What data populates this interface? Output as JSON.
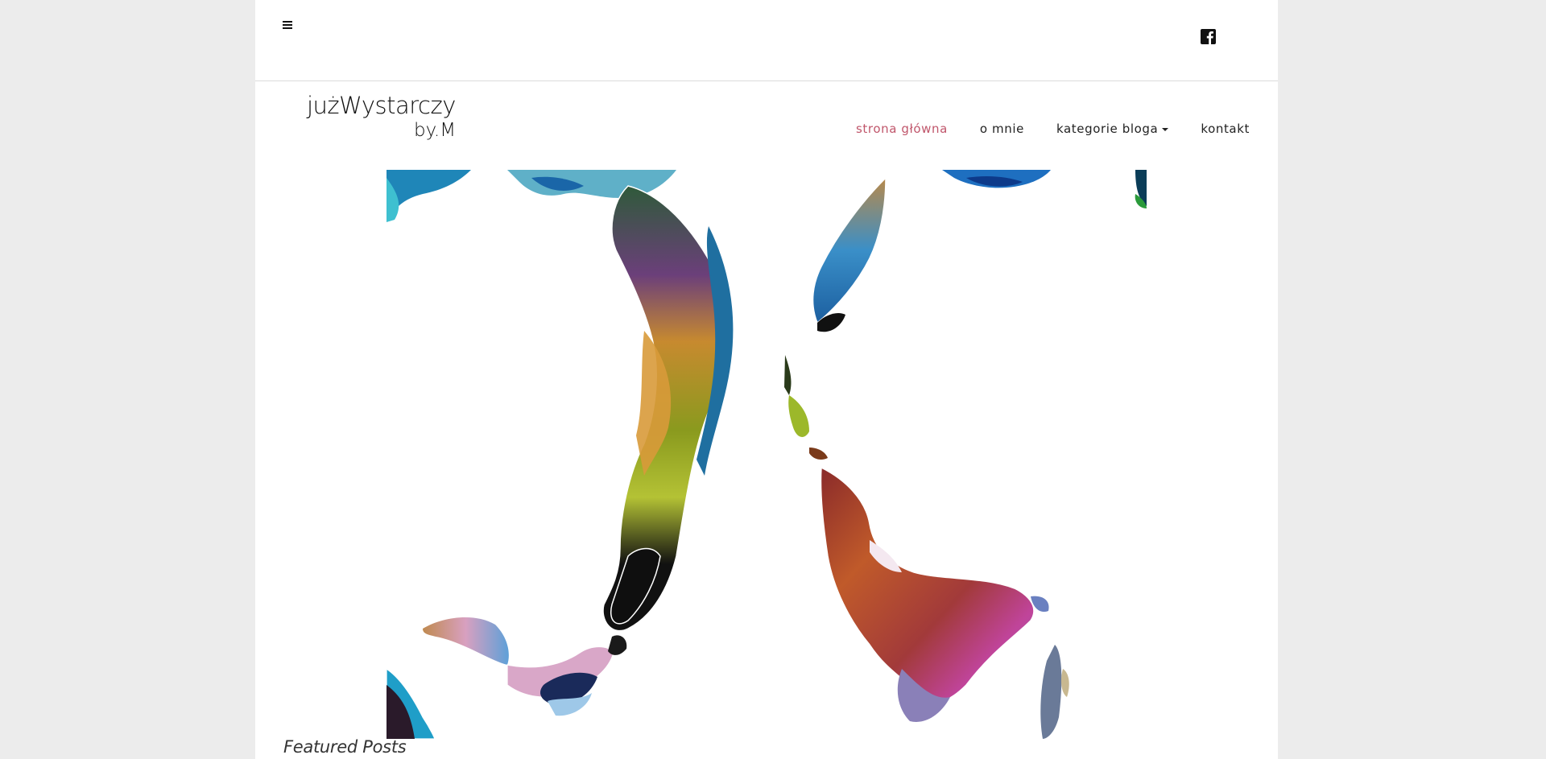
{
  "header": {
    "menu_icon": "hamburger-icon",
    "social_icon": "facebook-icon"
  },
  "logo": {
    "line1": "jużWystarczy",
    "line2": "by.M"
  },
  "nav": {
    "items": [
      {
        "label": "strona główna",
        "active": true
      },
      {
        "label": "o mnie",
        "active": false
      },
      {
        "label": "kategorie bloga",
        "active": false,
        "dropdown": true
      },
      {
        "label": "kontakt",
        "active": false
      }
    ]
  },
  "hero": {
    "image_alt": "abstract colorful face profiles"
  },
  "featured": {
    "title": "Featured Posts"
  },
  "colors": {
    "accent": "#c0566b",
    "background": "#ececec",
    "page": "#ffffff"
  }
}
